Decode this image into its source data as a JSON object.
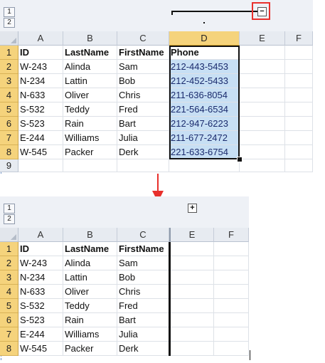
{
  "outline_levels": [
    "1",
    "2"
  ],
  "columns_top": [
    "A",
    "B",
    "C",
    "D",
    "E",
    "F"
  ],
  "columns_bottom": [
    "A",
    "B",
    "C",
    "E",
    "F"
  ],
  "row_numbers_top": [
    "1",
    "2",
    "3",
    "4",
    "5",
    "6",
    "7",
    "8",
    "9"
  ],
  "row_numbers_bottom": [
    "1",
    "2",
    "3",
    "4",
    "5",
    "6",
    "7",
    "8"
  ],
  "collapse_symbol": "−",
  "expand_symbol": "+",
  "header": {
    "id": "ID",
    "last": "LastName",
    "first": "FirstName",
    "phone": "Phone"
  },
  "rows": [
    {
      "id": "W-243",
      "last": "Alinda",
      "first": "Sam",
      "phone": "212-443-5453"
    },
    {
      "id": "N-234",
      "last": "Lattin",
      "first": "Bob",
      "phone": "212-452-5433"
    },
    {
      "id": "N-633",
      "last": "Oliver",
      "first": "Chris",
      "phone": "211-636-8054"
    },
    {
      "id": "S-532",
      "last": "Teddy",
      "first": "Fred",
      "phone": "221-564-6534"
    },
    {
      "id": "S-523",
      "last": "Rain",
      "first": "Bart",
      "phone": "212-947-6223"
    },
    {
      "id": "E-244",
      "last": "Williams",
      "first": "Julia",
      "phone": "211-677-2472"
    },
    {
      "id": "W-545",
      "last": "Packer",
      "first": "Derk",
      "phone": "221-633-6754"
    }
  ],
  "colors": {
    "selection_fill": "#c7dff4",
    "highlight_header": "#f5d37c",
    "callout_red": "#e8302c",
    "arrow_red": "#e8302c"
  }
}
